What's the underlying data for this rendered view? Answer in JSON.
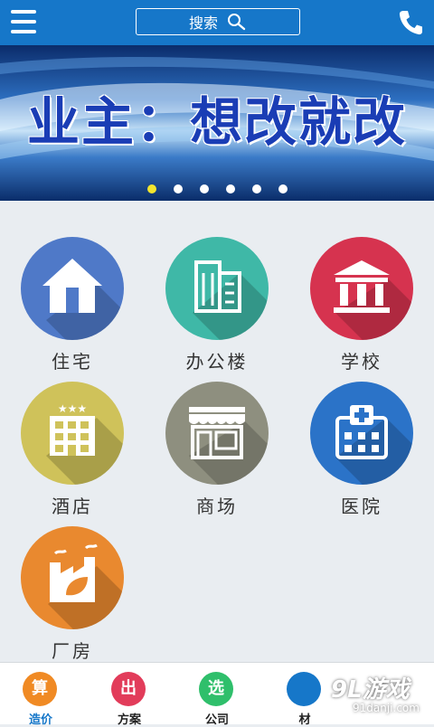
{
  "header": {
    "menu_icon": "menu-icon",
    "search_label": "搜索",
    "search_icon": "search-icon",
    "phone_icon": "phone-icon",
    "background_color": "#1677c9"
  },
  "banner": {
    "slogan": "业主：想改就改",
    "dots_total": 6,
    "active_dot": 1
  },
  "categories": [
    {
      "label": "住宅",
      "icon": "house-icon",
      "color": "#4f79c8"
    },
    {
      "label": "办公楼",
      "icon": "office-building-icon",
      "color": "#3fb8a7"
    },
    {
      "label": "学校",
      "icon": "school-icon",
      "color": "#d6334f"
    },
    {
      "label": "酒店",
      "icon": "hotel-icon",
      "color": "#cfc25a"
    },
    {
      "label": "商场",
      "icon": "mall-icon",
      "color": "#8e8f7f"
    },
    {
      "label": "医院",
      "icon": "hospital-icon",
      "color": "#2b73c8"
    },
    {
      "label": "厂房",
      "icon": "factory-icon",
      "color": "#e9892f"
    }
  ],
  "bottom_nav": [
    {
      "glyph": "算",
      "label": "造价",
      "color": "#f08a24",
      "active": true
    },
    {
      "glyph": "出",
      "label": "方案",
      "color": "#e23c5a",
      "active": false
    },
    {
      "glyph": "选",
      "label": "公司",
      "color": "#2fbf6b",
      "active": false
    },
    {
      "glyph": "",
      "label": "材",
      "color": "#1677c9",
      "active": false
    }
  ],
  "watermark": {
    "main": "9L游戏",
    "sub": "91danji.com"
  }
}
